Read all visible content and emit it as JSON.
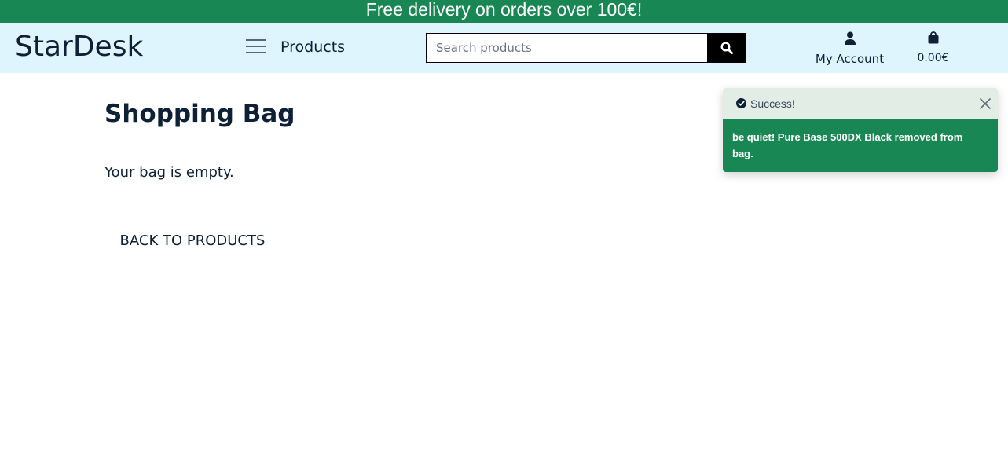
{
  "banner": {
    "text": "Free delivery on orders over 100€!"
  },
  "header": {
    "logo": "StarDesk",
    "menu_label": "Products",
    "search": {
      "placeholder": "Search products",
      "value": ""
    },
    "account_label": "My Account",
    "bag_total": "0.00€"
  },
  "main": {
    "title": "Shopping Bag",
    "empty_message": "Your bag is empty.",
    "back_button": "BACK TO PRODUCTS"
  },
  "toast": {
    "title": "Success!",
    "message": "be quiet! Pure Base 500DX Black removed from bag."
  },
  "colors": {
    "banner_bg": "#198754",
    "navbar_bg": "#def5fd",
    "text": "#0d2036",
    "toast_body_bg": "#198754",
    "toast_header_bg": "#e2ede6"
  },
  "icons": [
    "hamburger-menu-icon",
    "search-icon",
    "user-icon",
    "shopping-bag-icon",
    "check-circle-icon",
    "close-icon"
  ]
}
